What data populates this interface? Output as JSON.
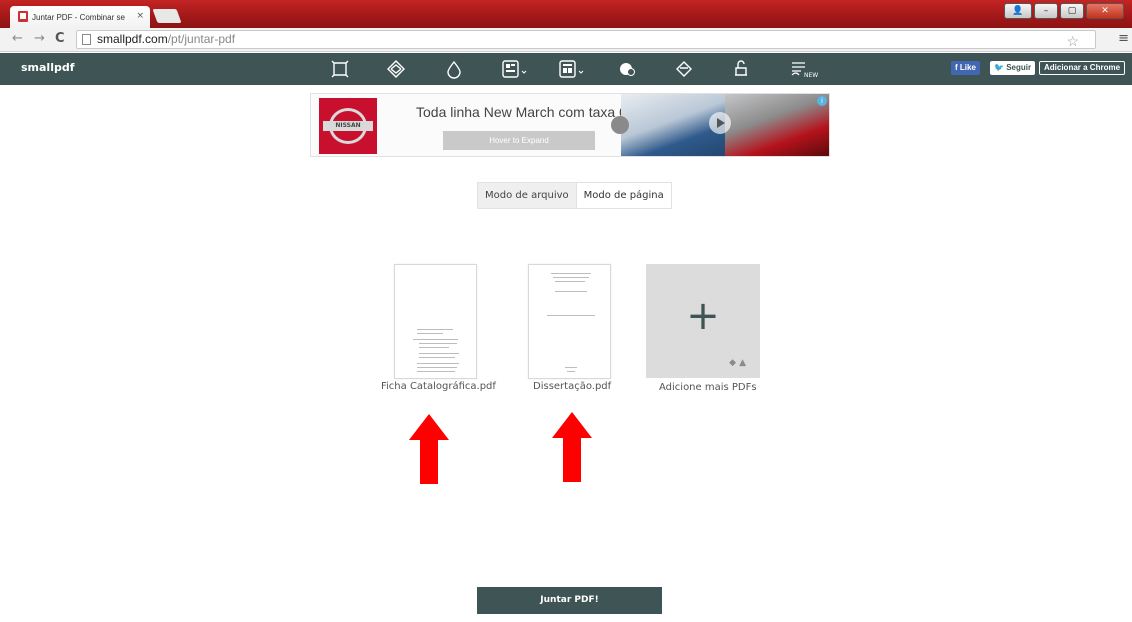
{
  "browser": {
    "tab_title": "Juntar PDF - Combinar se",
    "tab_close": "×",
    "url_host": "smallpdf.com",
    "url_path": "/pt/juntar-pdf",
    "window_buttons": [
      "–",
      "▢",
      "✕"
    ]
  },
  "header": {
    "logo": "smallpdf",
    "tools": [
      {
        "icon": "crop-icon"
      },
      {
        "icon": "compress-icon"
      },
      {
        "icon": "drop-icon"
      },
      {
        "icon": "convert-to-pdf-icon"
      },
      {
        "icon": "convert-from-pdf-icon"
      },
      {
        "icon": "unlock-icon"
      },
      {
        "icon": "diamond-icon"
      },
      {
        "icon": "lock-icon"
      },
      {
        "icon": "esign-icon",
        "badge": "NEW"
      }
    ],
    "facebook_label": "Like",
    "twitter_label": "Seguir",
    "chrome_label": "Adicionar a Chrome"
  },
  "ad": {
    "brand": "NISSAN",
    "headline": "Toda linha New March com taxa 0",
    "cta": "Hover to Expand",
    "info": "i"
  },
  "modes": {
    "file_mode": "Modo de arquivo",
    "page_mode": "Modo de página"
  },
  "files": [
    {
      "name": "Ficha Catalográfica.pdf"
    },
    {
      "name": "Dissertação.pdf"
    }
  ],
  "add_more": {
    "plus": "+",
    "label": "Adicione mais PDFs"
  },
  "merge_button": "Juntar PDF!",
  "colors": {
    "header_bg": "#3f5454",
    "arrow": "#ff0000",
    "title_bar": "#b01c1c"
  }
}
